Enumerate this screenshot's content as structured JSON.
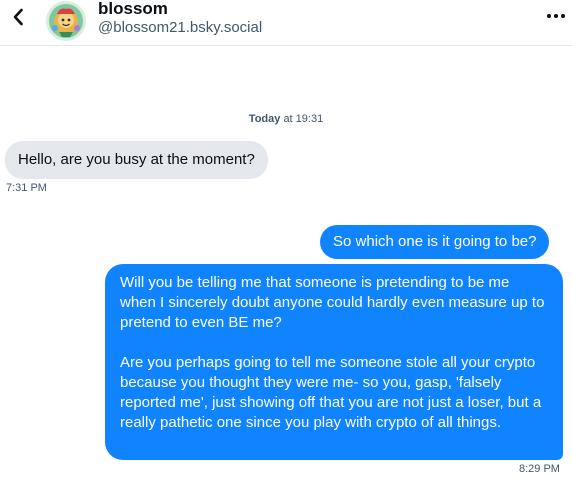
{
  "header": {
    "display_name": "blossom",
    "handle": "@blossom21.bsky.social",
    "back_icon": "chevron-left-icon",
    "more_icon": "ellipsis-icon"
  },
  "conversation": {
    "date_label_bold": "Today",
    "date_label_time": "at 19:31",
    "messages": [
      {
        "direction": "received",
        "text": "Hello, are you busy at the moment?",
        "time": "7:31 PM"
      },
      {
        "direction": "sent",
        "text": "So which one is it going to be?"
      },
      {
        "direction": "sent",
        "paragraphs": [
          "Will you be telling me that someone is pretending to be me when I sincerely doubt anyone could hardly even measure up to pretend to even BE me?",
          "Are you perhaps going to tell me someone stole all your crypto because you thought they were me- so you, gasp, 'falsely reported me', just showing off that you are not just a loser, but a really pathetic one since you play with crypto of all things."
        ],
        "time": "8:29 PM"
      }
    ]
  },
  "colors": {
    "sent_bubble": "#1083fe",
    "received_bubble": "#e4e8ec",
    "muted_text": "#42576c"
  }
}
